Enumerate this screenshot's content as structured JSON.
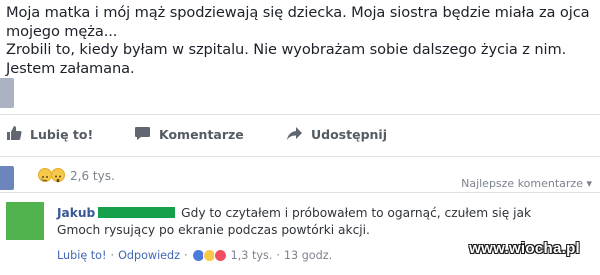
{
  "post": {
    "text": "Moja matka i mój mąż spodziewają się dziecka. Moja siostra będzie miała za ojca mojego męża...\nZrobili to, kiedy byłam w szpitalu. Nie wyobrażam sobie dalszego życia z nim. Jestem załamana."
  },
  "actions": {
    "like": "Lubię to!",
    "comment": "Komentarze",
    "share": "Udostępnij"
  },
  "reactions": {
    "icons": [
      "sad-emoji",
      "wow-emoji"
    ],
    "count": "2,6 tys.",
    "sort_label": "Najlepsze komentarze ▾"
  },
  "comment": {
    "author": "Jakub",
    "text": "Gdy to czytałem i próbowałem to ogarnąć, czułem się jak Gmoch rysujący po ekranie podczas powtórki akcji.",
    "like_label": "Lubię to!",
    "reply_label": "Odpowiedz",
    "reaction_count": "1,3 tys.",
    "time": "13 godz."
  },
  "watermark": "www.wiocha.pl",
  "colors": {
    "link": "#385898",
    "reaction_yellow": "#f6c84c",
    "redaction_green": "#16a04c"
  }
}
